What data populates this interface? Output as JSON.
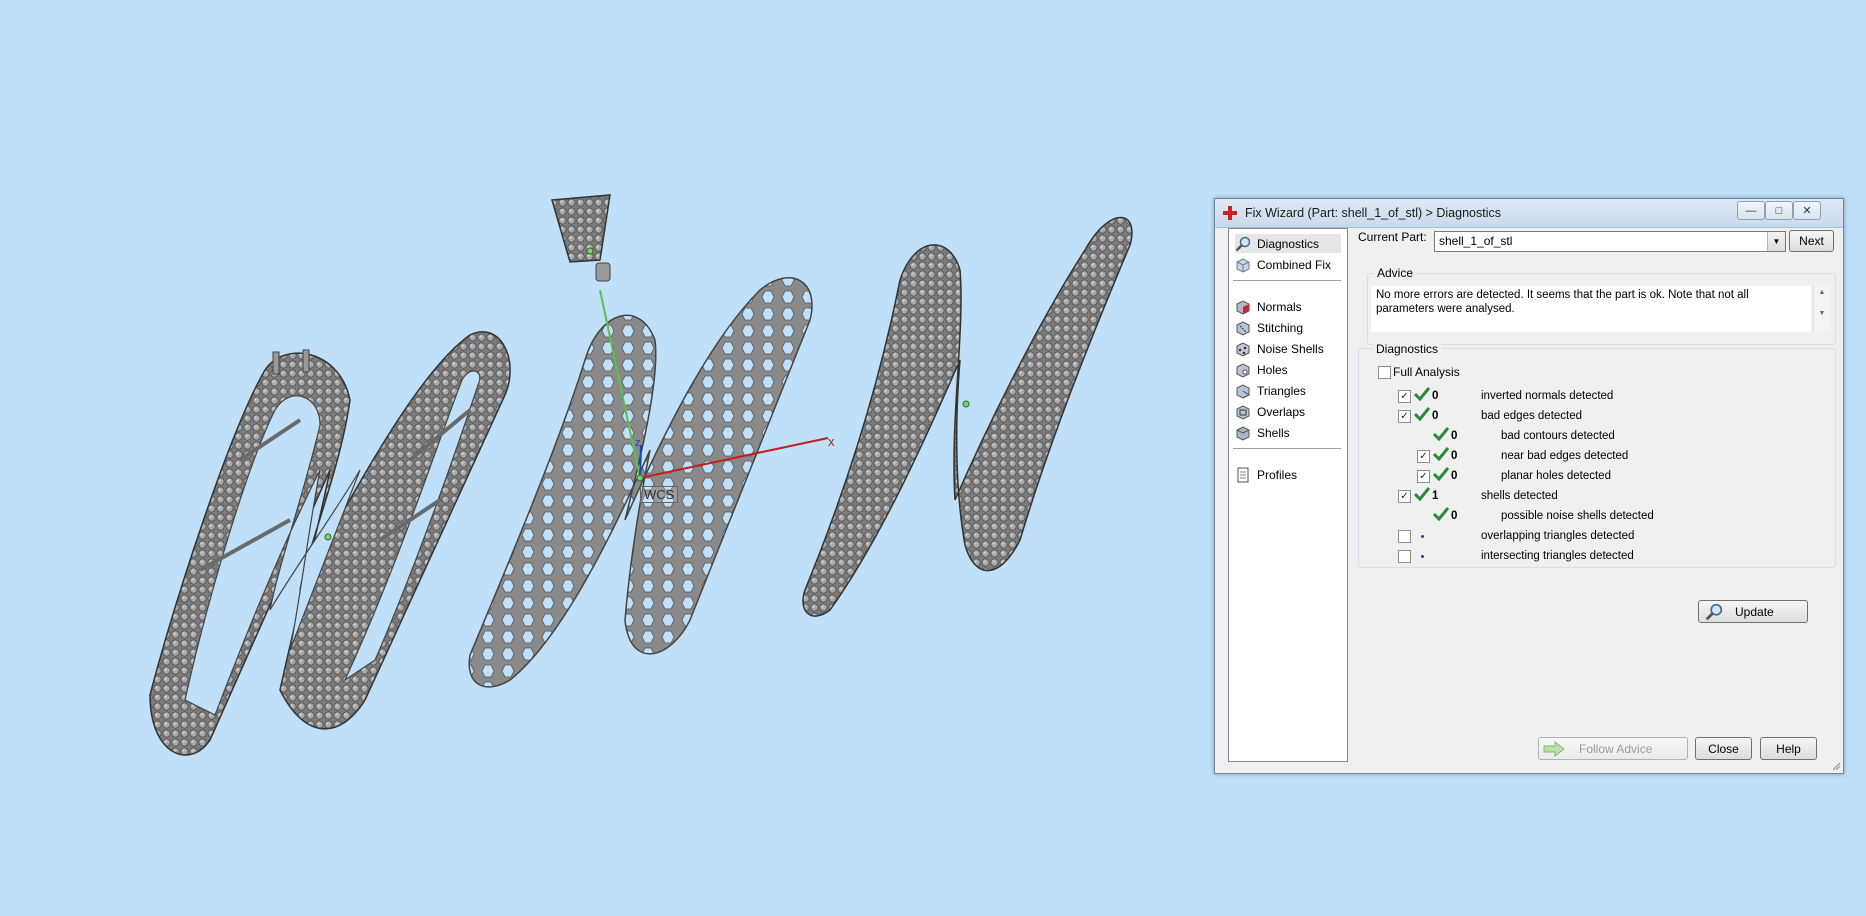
{
  "viewport": {
    "wcs_label": "WCS",
    "axis_x_label": "x",
    "axis_z_label": "z"
  },
  "dialog": {
    "title": "Fix Wizard (Part: shell_1_of_stl) > Diagnostics",
    "nav": {
      "top": [
        {
          "label": "Diagnostics",
          "icon": "magnifier-icon",
          "selected": true
        },
        {
          "label": "Combined Fix",
          "icon": "cube-icon",
          "selected": false
        }
      ],
      "middle": [
        {
          "label": "Normals",
          "icon": "normals-cube-icon"
        },
        {
          "label": "Stitching",
          "icon": "stitching-cube-icon"
        },
        {
          "label": "Noise Shells",
          "icon": "noise-shells-cube-icon"
        },
        {
          "label": "Holes",
          "icon": "holes-cube-icon"
        },
        {
          "label": "Triangles",
          "icon": "triangles-cube-icon"
        },
        {
          "label": "Overlaps",
          "icon": "overlaps-cube-icon"
        },
        {
          "label": "Shells",
          "icon": "shells-cube-icon"
        }
      ],
      "bottom": [
        {
          "label": "Profiles",
          "icon": "document-icon"
        }
      ]
    },
    "current_part_label": "Current Part:",
    "current_part_value": "shell_1_of_stl",
    "next_button": "Next",
    "advice": {
      "title": "Advice",
      "text": "No more errors are detected. It seems that the part is ok. Note that not all parameters were analysed."
    },
    "diagnostics": {
      "title": "Diagnostics",
      "full_analysis_label": "Full Analysis",
      "full_analysis_checked": false,
      "rows": [
        {
          "checked": true,
          "status": "ok",
          "value": "0",
          "label": "inverted normals detected",
          "indent": 0,
          "has_checkbox": true
        },
        {
          "checked": true,
          "status": "ok",
          "value": "0",
          "label": "bad edges detected",
          "indent": 0,
          "has_checkbox": true
        },
        {
          "checked": null,
          "status": "ok",
          "value": "0",
          "label": "bad contours detected",
          "indent": 1,
          "has_checkbox": false
        },
        {
          "checked": true,
          "status": "ok",
          "value": "0",
          "label": "near bad edges detected",
          "indent": 1,
          "has_checkbox": true
        },
        {
          "checked": true,
          "status": "ok",
          "value": "0",
          "label": "planar holes detected",
          "indent": 1,
          "has_checkbox": true
        },
        {
          "checked": true,
          "status": "ok",
          "value": "1",
          "label": "shells detected",
          "indent": 0,
          "has_checkbox": true
        },
        {
          "checked": null,
          "status": "ok",
          "value": "0",
          "label": "possible noise shells detected",
          "indent": 1,
          "has_checkbox": false
        },
        {
          "checked": false,
          "status": "unknown",
          "value": "",
          "label": "overlapping triangles detected",
          "indent": 0,
          "has_checkbox": true
        },
        {
          "checked": false,
          "status": "unknown",
          "value": "",
          "label": "intersecting triangles detected",
          "indent": 0,
          "has_checkbox": true
        }
      ],
      "update_button": "Update"
    },
    "follow_advice_button": "Follow Advice",
    "close_button": "Close",
    "help_button": "Help"
  }
}
